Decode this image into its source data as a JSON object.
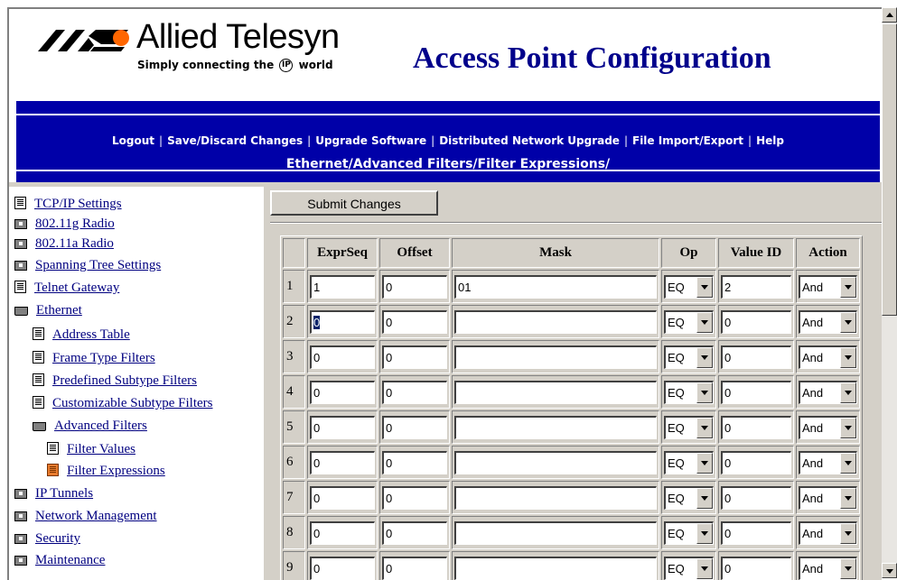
{
  "header": {
    "logo_text": "Allied Telesyn",
    "tagline_pre": "Simply connecting the",
    "tagline_ip": "IP",
    "tagline_post": "world",
    "title": "Access Point Configuration"
  },
  "nav": {
    "links": [
      "Logout",
      "Save/Discard Changes",
      "Upgrade Software",
      "Distributed Network Upgrade",
      "File Import/Export",
      "Help"
    ],
    "separator": "|",
    "breadcrumb": "Ethernet/Advanced Filters/Filter Expressions/"
  },
  "sidebar": {
    "items": [
      {
        "label": "TCP/IP Settings",
        "icon": "document-icon"
      },
      {
        "label": "802.11g Radio",
        "icon": "folder-closed-icon"
      },
      {
        "label": "802.11a Radio",
        "icon": "folder-closed-icon"
      },
      {
        "label": "Spanning Tree Settings",
        "icon": "folder-closed-icon"
      },
      {
        "label": "Telnet Gateway",
        "icon": "document-icon"
      },
      {
        "label": "Ethernet",
        "icon": "folder-open-icon"
      },
      {
        "label": "Address Table",
        "icon": "document-icon"
      },
      {
        "label": "Frame Type Filters",
        "icon": "document-icon"
      },
      {
        "label": "Predefined Subtype Filters",
        "icon": "document-icon"
      },
      {
        "label": "Customizable Subtype Filters",
        "icon": "document-icon"
      },
      {
        "label": "Advanced Filters",
        "icon": "folder-open-icon"
      },
      {
        "label": "Filter Values",
        "icon": "document-icon"
      },
      {
        "label": "Filter Expressions",
        "icon": "document-selected-icon"
      },
      {
        "label": "IP Tunnels",
        "icon": "folder-closed-icon"
      },
      {
        "label": "Network Management",
        "icon": "folder-closed-icon"
      },
      {
        "label": "Security",
        "icon": "folder-closed-icon"
      },
      {
        "label": "Maintenance",
        "icon": "folder-closed-icon"
      }
    ]
  },
  "main": {
    "submit_label": "Submit Changes",
    "columns": [
      "",
      "ExprSeq",
      "Offset",
      "Mask",
      "Op",
      "Value ID",
      "Action"
    ],
    "rows": [
      {
        "n": "1",
        "exprseq": "1",
        "offset": "0",
        "mask": "01",
        "op": "EQ",
        "value_id": "2",
        "action": "And"
      },
      {
        "n": "2",
        "exprseq": "0",
        "offset": "0",
        "mask": "",
        "op": "EQ",
        "value_id": "0",
        "action": "And"
      },
      {
        "n": "3",
        "exprseq": "0",
        "offset": "0",
        "mask": "",
        "op": "EQ",
        "value_id": "0",
        "action": "And"
      },
      {
        "n": "4",
        "exprseq": "0",
        "offset": "0",
        "mask": "",
        "op": "EQ",
        "value_id": "0",
        "action": "And"
      },
      {
        "n": "5",
        "exprseq": "0",
        "offset": "0",
        "mask": "",
        "op": "EQ",
        "value_id": "0",
        "action": "And"
      },
      {
        "n": "6",
        "exprseq": "0",
        "offset": "0",
        "mask": "",
        "op": "EQ",
        "value_id": "0",
        "action": "And"
      },
      {
        "n": "7",
        "exprseq": "0",
        "offset": "0",
        "mask": "",
        "op": "EQ",
        "value_id": "0",
        "action": "And"
      },
      {
        "n": "8",
        "exprseq": "0",
        "offset": "0",
        "mask": "",
        "op": "EQ",
        "value_id": "0",
        "action": "And"
      },
      {
        "n": "9",
        "exprseq": "0",
        "offset": "0",
        "mask": "",
        "op": "EQ",
        "value_id": "0",
        "action": "And"
      }
    ]
  },
  "colors": {
    "nav_band": "#0000a8",
    "title": "#00008b",
    "link": "#000080",
    "selected_icon": "#e87b2d",
    "chrome": "#d4d0c8"
  }
}
